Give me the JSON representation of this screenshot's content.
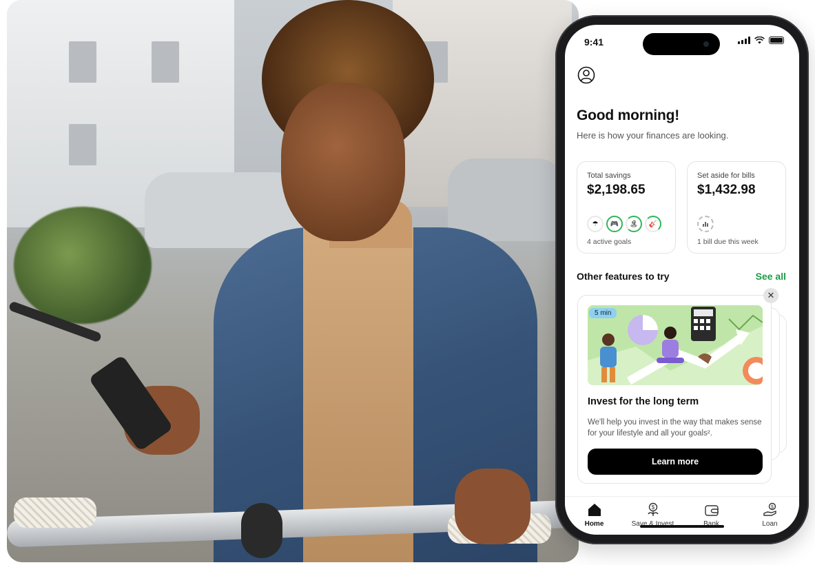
{
  "colors": {
    "accent_green": "#1f9a46",
    "button_bg": "#000000",
    "badge_bg": "#8fd0f0"
  },
  "status_bar": {
    "time": "9:41"
  },
  "header": {
    "greeting": "Good morning!",
    "subtitle": "Here is how your finances are looking."
  },
  "cards": {
    "savings": {
      "label": "Total savings",
      "amount": "$2,198.65",
      "footer": "4 active goals",
      "goal_icons": [
        "umbrella-icon",
        "gamepad-icon",
        "island-icon",
        "guitar-icon"
      ]
    },
    "bills": {
      "label": "Set aside for bills",
      "amount": "$1,432.98",
      "footer": "1 bill due this week"
    }
  },
  "features": {
    "title": "Other features to try",
    "see_all": "See all",
    "card": {
      "badge": "5 min",
      "title": "Invest for the long term",
      "description": "We'll help you invest in the way that makes sense for your lifestyle and all your goals².",
      "button": "Learn more"
    }
  },
  "tabs": [
    {
      "label": "Home",
      "icon": "home-icon",
      "active": true
    },
    {
      "label": "Save & Invest",
      "icon": "save-invest-icon",
      "active": false
    },
    {
      "label": "Bank",
      "icon": "wallet-icon",
      "active": false
    },
    {
      "label": "Loan",
      "icon": "loan-icon",
      "active": false
    }
  ]
}
